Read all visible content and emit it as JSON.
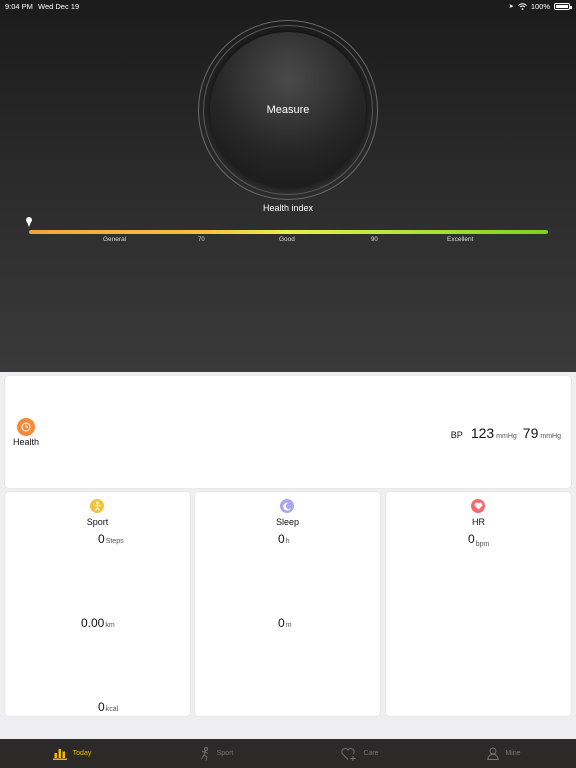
{
  "status_bar": {
    "time": "9:04 PM",
    "date": "Wed Dec 19",
    "battery": "100%"
  },
  "measure": {
    "label": "Measure"
  },
  "health_index": {
    "title": "Health index",
    "zones": [
      "General",
      "Good",
      "Excellent"
    ],
    "thresholds": [
      "70",
      "90"
    ]
  },
  "health_card": {
    "label": "Health",
    "bp_label": "BP",
    "systolic": "123",
    "systolic_unit": "mmHg",
    "diastolic": "79",
    "diastolic_unit": "mmHg"
  },
  "sport": {
    "title": "Sport",
    "steps": "0",
    "steps_unit": "Steps",
    "distance": "0.00",
    "distance_unit": "km",
    "calories": "0",
    "calories_unit": "kcal"
  },
  "sleep": {
    "title": "Sleep",
    "hours": "0",
    "hours_unit": "h",
    "minutes": "0",
    "minutes_unit": "m"
  },
  "hr": {
    "title": "HR",
    "value": "0",
    "unit": "bpm"
  },
  "tabs": [
    {
      "label": "Today",
      "icon": "bar-chart-icon"
    },
    {
      "label": "Sport",
      "icon": "runner-icon"
    },
    {
      "label": "Care",
      "icon": "heart-plus-icon"
    },
    {
      "label": "Mine",
      "icon": "user-icon"
    }
  ],
  "colors": {
    "accent": "#f0b800",
    "health_icon": "#f38b3a",
    "sport_icon": "#f5c040",
    "sleep_icon": "#a9a7f0",
    "hr_icon": "#f26b6b"
  }
}
